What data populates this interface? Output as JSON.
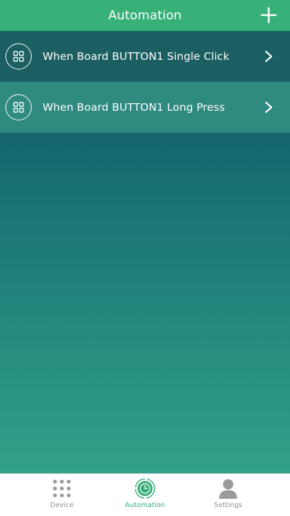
{
  "header": {
    "title": "Automation",
    "add_icon": "plus-icon"
  },
  "rules": [
    {
      "label": "When Board BUTTON1 Single Click",
      "icon": "grid-icon"
    },
    {
      "label": "When Board BUTTON1 Long Press",
      "icon": "grid-icon"
    }
  ],
  "tabbar": {
    "tabs": [
      {
        "label": "Device",
        "icon": "dots-grid-icon",
        "active": false
      },
      {
        "label": "Automation",
        "icon": "clock-icon",
        "active": true
      },
      {
        "label": "Settings",
        "icon": "person-icon",
        "active": false
      }
    ]
  },
  "colors": {
    "header": "#38b07a",
    "accent": "#3aae78",
    "gradient_top": "#0f5567",
    "gradient_bottom": "#33a088",
    "inactive_tab": "#8e8e93"
  }
}
